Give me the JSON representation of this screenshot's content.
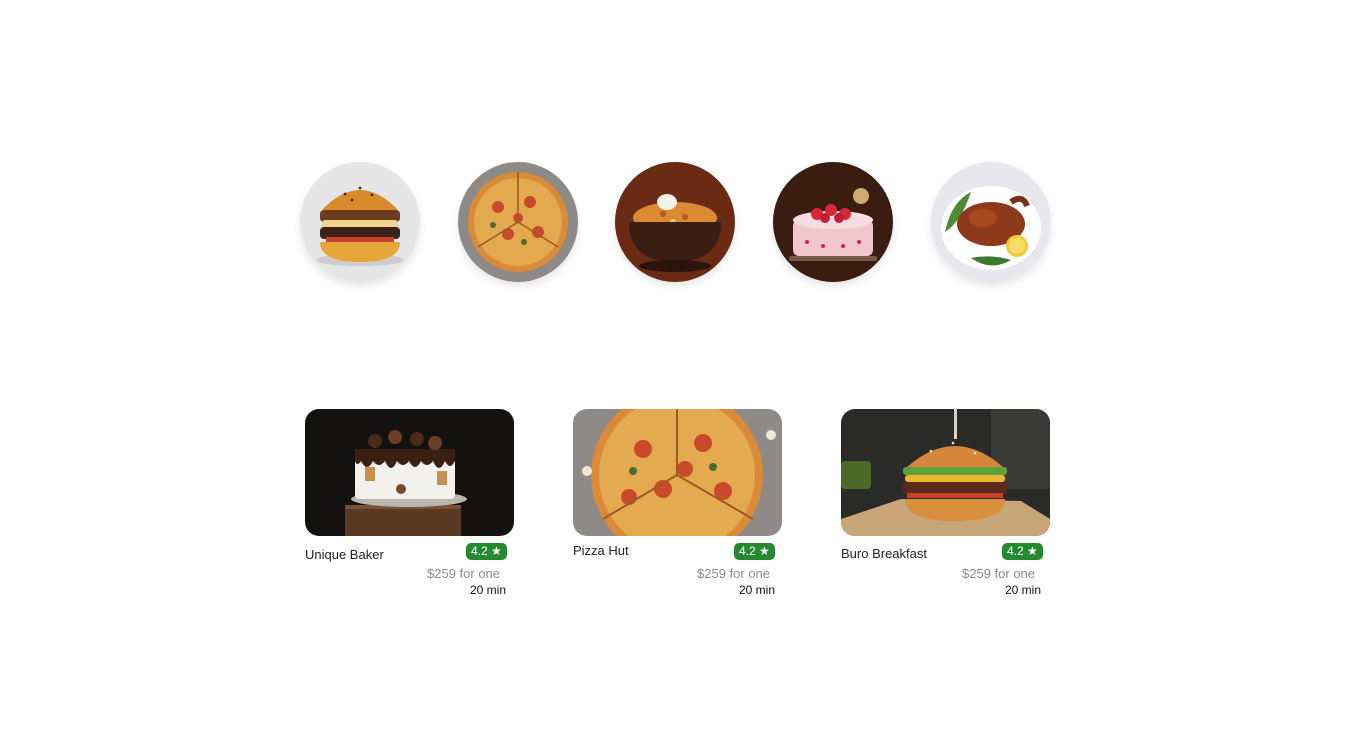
{
  "categories": [
    {
      "name": "Burger",
      "icon": "burger-icon"
    },
    {
      "name": "Pizza",
      "icon": "pizza-icon"
    },
    {
      "name": "Biryani",
      "icon": "biryani-icon"
    },
    {
      "name": "Cake",
      "icon": "cake-icon"
    },
    {
      "name": "Chicken",
      "icon": "roast-chicken-icon"
    }
  ],
  "restaurants": [
    {
      "name": "Unique Baker",
      "rating": "4.2 ★",
      "price": "$259 for one",
      "eta": "20 min"
    },
    {
      "name": "Pizza Hut",
      "rating": "4.2 ★",
      "price": "$259 for one",
      "eta": "20 min"
    },
    {
      "name": "Buro Breakfast",
      "rating": "4.2 ★",
      "price": "$259 for one",
      "eta": "20 min"
    }
  ],
  "colors": {
    "rating_badge": "#258a2f",
    "price_text": "#8a8a8a"
  }
}
